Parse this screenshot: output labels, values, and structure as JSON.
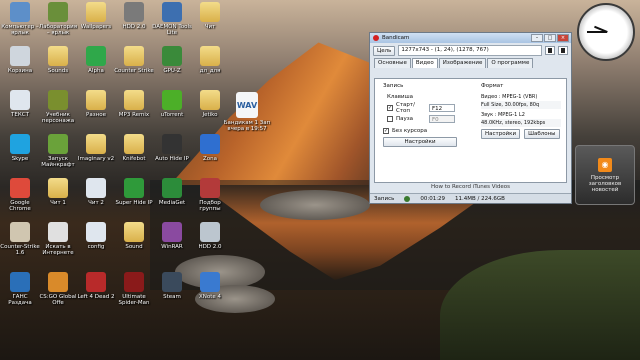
{
  "desktop": {
    "icons": [
      {
        "label": "Компьютер – ярлык",
        "icon": "computer-icon",
        "color": "#5d8fc9",
        "kind": "app"
      },
      {
        "label": "Лаборатория – ярлык",
        "icon": "lab-icon",
        "color": "#6a8f3a",
        "kind": "app"
      },
      {
        "label": "Wallpapers",
        "icon": "folder-icon",
        "color": "#e3c35e",
        "kind": "folder"
      },
      {
        "label": "HDD 2.0",
        "icon": "drive-icon",
        "color": "#7a7a7a",
        "kind": "app"
      },
      {
        "label": "DAEMON Tools Lite",
        "icon": "daemon-icon",
        "color": "#3d6fb0",
        "kind": "app"
      },
      {
        "label": "Чит",
        "icon": "folder-icon",
        "color": "#e3c35e",
        "kind": "folder"
      },
      {
        "label": "Корзина",
        "icon": "recycle-bin-icon",
        "color": "#cfd6dd",
        "kind": "app"
      },
      {
        "label": "Sounds",
        "icon": "folder-icon",
        "color": "#e3c35e",
        "kind": "folder"
      },
      {
        "label": "Alpha",
        "icon": "alpha-icon",
        "color": "#2fa84a",
        "kind": "app"
      },
      {
        "label": "Counter Strike",
        "icon": "folder-icon",
        "color": "#e3c35e",
        "kind": "folder"
      },
      {
        "label": "GPU-Z",
        "icon": "gpu-icon",
        "color": "#3a8a3a",
        "kind": "app"
      },
      {
        "label": "дл_для",
        "icon": "folder-icon",
        "color": "#e3c35e",
        "kind": "folder"
      },
      {
        "label": "ТЕКСТ",
        "icon": "text-file-icon",
        "color": "#dfe6ee",
        "kind": "app"
      },
      {
        "label": "Учебник персонажа",
        "icon": "book-icon",
        "color": "#7a8f2e",
        "kind": "app"
      },
      {
        "label": "Разное",
        "icon": "folder-icon",
        "color": "#e3c35e",
        "kind": "folder"
      },
      {
        "label": "MP3 Remix",
        "icon": "folder-icon",
        "color": "#e3c35e",
        "kind": "folder"
      },
      {
        "label": "uTorrent",
        "icon": "play-icon",
        "color": "#4caf28",
        "kind": "app"
      },
      {
        "label": "Jetiko",
        "icon": "folder-icon",
        "color": "#e3c35e",
        "kind": "folder"
      },
      {
        "label": "Skype",
        "icon": "skype-icon",
        "color": "#1fa3e0",
        "kind": "app"
      },
      {
        "label": "Запуск Майнкрафт",
        "icon": "minecraft-icon",
        "color": "#6aa23a",
        "kind": "app"
      },
      {
        "label": "Imaginary v2",
        "icon": "folder-icon",
        "color": "#e3c35e",
        "kind": "folder"
      },
      {
        "label": "Knifebot",
        "icon": "folder-icon",
        "color": "#e3c35e",
        "kind": "folder"
      },
      {
        "label": "Auto Hide IP",
        "icon": "hide-ip-icon",
        "color": "#333333",
        "kind": "app"
      },
      {
        "label": "Zona",
        "icon": "zona-icon",
        "color": "#2f6fd0",
        "kind": "app"
      },
      {
        "label": "Google Chrome",
        "icon": "chrome-icon",
        "color": "#de4a3b",
        "kind": "app"
      },
      {
        "label": "Чит 1",
        "icon": "folder-icon",
        "color": "#e3c35e",
        "kind": "folder"
      },
      {
        "label": "Чит 2",
        "icon": "text-file-icon",
        "color": "#dfe6ee",
        "kind": "app"
      },
      {
        "label": "Super Hide IP",
        "icon": "ip-icon",
        "color": "#2f9a3a",
        "kind": "app"
      },
      {
        "label": "MediaGet",
        "icon": "mediaget-icon",
        "color": "#2c8c3a",
        "kind": "app"
      },
      {
        "label": "Подбор группы",
        "icon": "group-icon",
        "color": "#b33a3a",
        "kind": "app"
      },
      {
        "label": "Counter-Strike 1.6",
        "icon": "cs-icon",
        "color": "#d0c6b0",
        "kind": "app"
      },
      {
        "label": "Искать в Интернете",
        "icon": "search-web-icon",
        "color": "#e0e0e0",
        "kind": "app"
      },
      {
        "label": "config",
        "icon": "text-file-icon",
        "color": "#dfe6ee",
        "kind": "app"
      },
      {
        "label": "Sound",
        "icon": "folder-icon",
        "color": "#e3c35e",
        "kind": "folder"
      },
      {
        "label": "WinRAR",
        "icon": "winrar-icon",
        "color": "#8a4aa0",
        "kind": "app"
      },
      {
        "label": "HDD 2.0",
        "icon": "disk-icon",
        "color": "#bcc6cf",
        "kind": "app"
      },
      {
        "label": "ГАНС Раздача",
        "icon": "user-icon",
        "color": "#2a6fb8",
        "kind": "app"
      },
      {
        "label": "CS:GO Global Offe",
        "icon": "csgo-icon",
        "color": "#d98a2a",
        "kind": "app"
      },
      {
        "label": "Left 4 Dead 2",
        "icon": "l4d2-icon",
        "color": "#b82a2a",
        "kind": "app"
      },
      {
        "label": "Ultimate Spider-Man",
        "icon": "spider-icon",
        "color": "#8a1a1a",
        "kind": "app"
      },
      {
        "label": "Steam",
        "icon": "steam-icon",
        "color": "#3a4a5c",
        "kind": "app"
      },
      {
        "label": "XNote 4",
        "icon": "note-icon",
        "color": "#3a7ad0",
        "kind": "app"
      }
    ],
    "file_card": {
      "label": "Бандикам 1 Зап вчера в 19:57",
      "badge": "WAV"
    }
  },
  "gadgets": {
    "clock": {
      "hour": 9,
      "minute": 45
    },
    "rss": {
      "label": "Просмотр заголовков новостей"
    }
  },
  "bandicam": {
    "title": "Bandicam",
    "target_button": "Цель",
    "size_text": "1277x743 - (1, 24), (1278, 767)",
    "tabs": [
      "Основные",
      "Видео",
      "Изображение",
      "О программе"
    ],
    "active_tab": 1,
    "record": {
      "section": "Запись",
      "hotkey_label": "Клавиша",
      "start_stop_label": "Старт/Стоп",
      "start_stop_key": "F12",
      "pause_label": "Пауза",
      "pause_key": "F0",
      "no_cursor_label": "Без курсора",
      "settings_button": "Настройки"
    },
    "format": {
      "section": "Формат",
      "video": "Видео : MPEG-1 (VBR)",
      "video_detail": "Full Size, 30.00fps, 80q",
      "audio": "Звук : MPEG-1 L2",
      "audio_detail": "48.0KHz, stereo, 192kbps",
      "settings_button": "Настройки",
      "templates_button": "Шаблоны"
    },
    "help_link": "How to Record iTunes Videos",
    "status": {
      "label": "Запись",
      "time": "00:01:29",
      "size": "11.4MB / 224.6GB"
    }
  }
}
